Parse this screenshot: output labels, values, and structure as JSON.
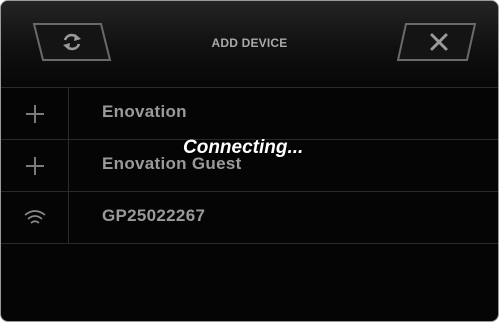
{
  "header": {
    "title": "ADD DEVICE",
    "refresh_icon": "refresh-icon",
    "close_icon": "close-icon"
  },
  "devices": [
    {
      "name": "Enovation",
      "icon": "plus-icon"
    },
    {
      "name": "Enovation Guest",
      "icon": "plus-icon"
    },
    {
      "name": "GP25022267",
      "icon": "wifi-icon"
    }
  ],
  "status": {
    "text": "Connecting..."
  },
  "colors": {
    "background": "#050505",
    "text": "#9a9a9a",
    "status_text": "#ffffff",
    "divider": "#2a2a2a"
  }
}
